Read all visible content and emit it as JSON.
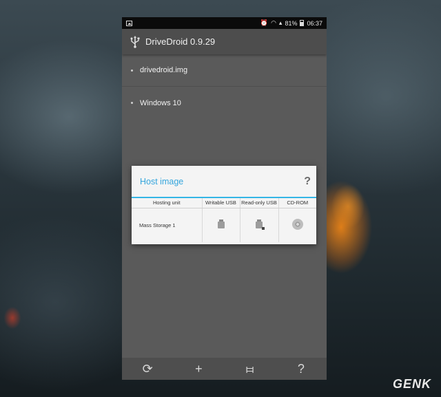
{
  "status_bar": {
    "battery": "81%",
    "time": "06:37",
    "icons": [
      "image-icon",
      "alarm-icon",
      "wifi-icon",
      "signal-icon",
      "battery-icon"
    ]
  },
  "app_bar": {
    "icon": "usb-icon",
    "title": "DriveDroid 0.9.29"
  },
  "images": [
    {
      "label": "drivedroid.img"
    },
    {
      "label": "Windows 10"
    }
  ],
  "dialog": {
    "title": "Host image",
    "help": "?",
    "columns": [
      "Hosting unit",
      "Writable USB",
      "Read-only USB",
      "CD-ROM"
    ],
    "rows": [
      {
        "unit": "Mass Storage 1",
        "options": [
          "usb-drive-icon",
          "usb-drive-readonly-icon",
          "cd-icon"
        ]
      }
    ]
  },
  "bottom_bar": {
    "buttons": [
      {
        "icon": "refresh-icon",
        "glyph": "⟳"
      },
      {
        "icon": "add-icon",
        "glyph": "+"
      },
      {
        "icon": "settings-sliders-icon",
        "glyph": "⧦"
      },
      {
        "icon": "help-icon",
        "glyph": "?"
      }
    ]
  },
  "watermark": {
    "text": "GENK"
  },
  "colors": {
    "accent": "#33b5e5",
    "dialog_bg": "#f4f4f4",
    "app_bar": "#4d4d4d"
  }
}
